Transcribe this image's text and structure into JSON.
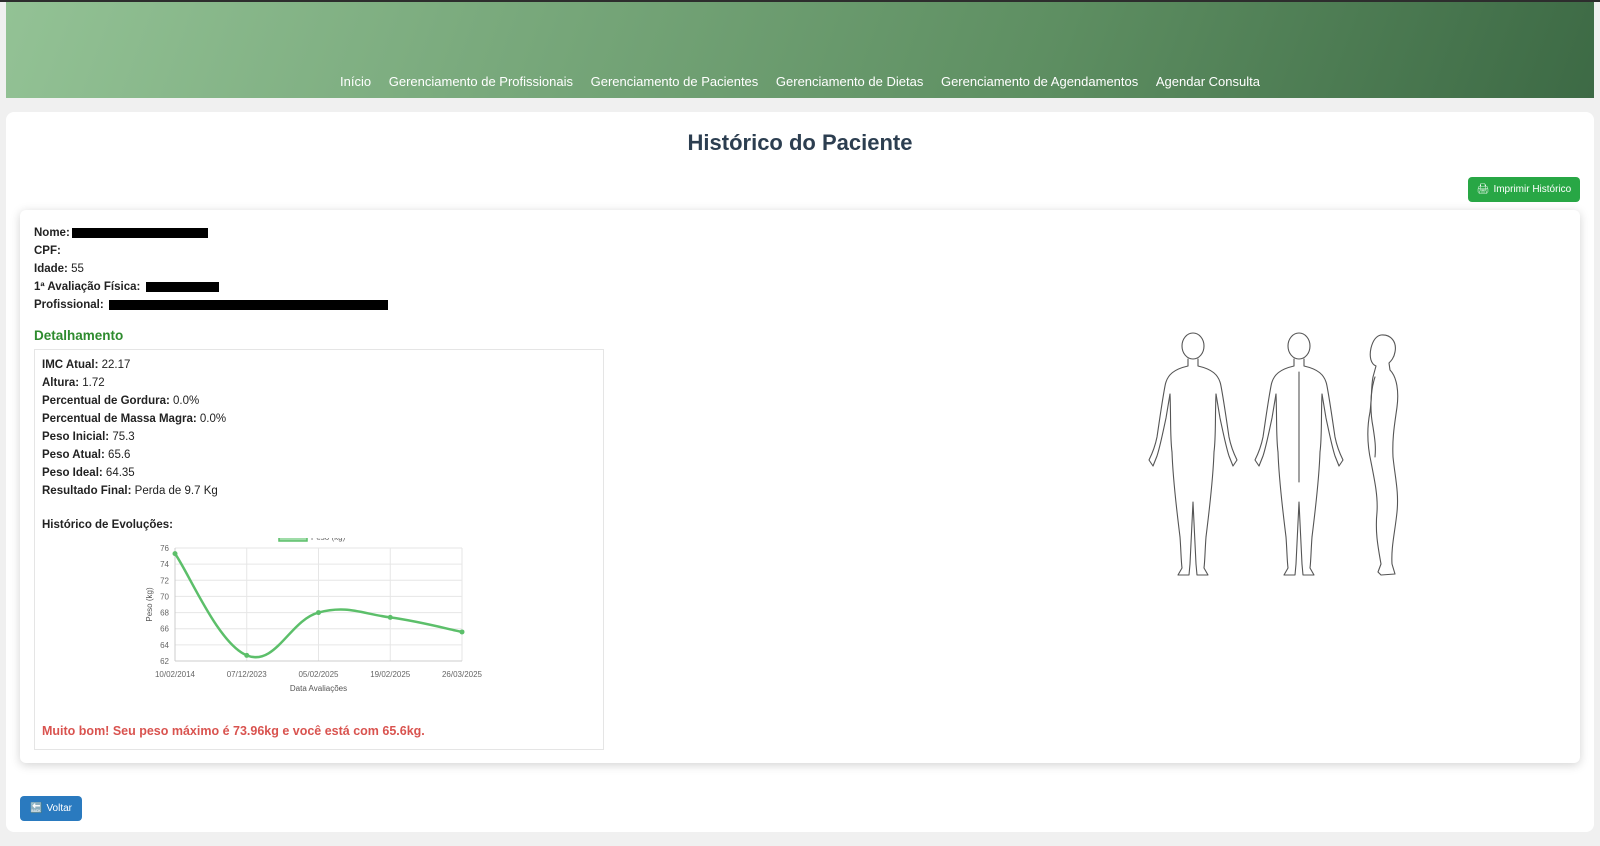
{
  "nav": {
    "items": [
      {
        "label": "Início"
      },
      {
        "label": "Gerenciamento de Profissionais"
      },
      {
        "label": "Gerenciamento de Pacientes"
      },
      {
        "label": "Gerenciamento de Dietas"
      },
      {
        "label": "Gerenciamento de Agendamentos"
      },
      {
        "label": "Agendar Consulta"
      }
    ]
  },
  "page": {
    "title": "Histórico do Paciente"
  },
  "actions": {
    "print_label": "Imprimir Histórico",
    "print_icon": "printer-icon",
    "back_label": "Voltar",
    "back_icon": "back-icon"
  },
  "patient": {
    "name_label": "Nome:",
    "cpf_label": "CPF:",
    "age_label": "Idade:",
    "age_value": "55",
    "first_eval_label": "1ª Avaliação Física:",
    "professional_label": "Profissional:"
  },
  "details": {
    "title": "Detalhamento",
    "rows": [
      {
        "label": "IMC Atual:",
        "value": "22.17"
      },
      {
        "label": "Altura:",
        "value": "1.72"
      },
      {
        "label": "Percentual de Gordura:",
        "value": "0.0%"
      },
      {
        "label": "Percentual de Massa Magra:",
        "value": "0.0%"
      },
      {
        "label": "Peso Inicial:",
        "value": "75.3"
      },
      {
        "label": "Peso Atual:",
        "value": "65.6"
      },
      {
        "label": "Peso Ideal:",
        "value": "64.35"
      },
      {
        "label": "Resultado Final:",
        "value": "Perda de 9.7 Kg"
      }
    ],
    "evolution_title": "Histórico de Evoluções:",
    "result_message": "Muito bom! Seu peso máximo é 73.96kg e você está com 65.6kg."
  },
  "chart_data": {
    "type": "line",
    "x": [
      "10/02/2014",
      "07/12/2023",
      "05/02/2025",
      "19/02/2025",
      "26/03/2025"
    ],
    "series": [
      {
        "name": "Peso (kg)",
        "values": [
          75.3,
          62.7,
          68.0,
          67.4,
          65.6
        ],
        "color": "#5cbf6a"
      }
    ],
    "xlabel": "Data Avaliações",
    "ylabel": "Peso (kg)",
    "ylim": [
      62,
      76
    ],
    "yticks": [
      62,
      64,
      66,
      68,
      70,
      72,
      74,
      76
    ],
    "grid": true,
    "legend": "top"
  },
  "colors": {
    "accent_green": "#28a745",
    "header_dark": "#3d6a45",
    "alert_red": "#d9534f",
    "button_blue": "#2a7abf"
  }
}
